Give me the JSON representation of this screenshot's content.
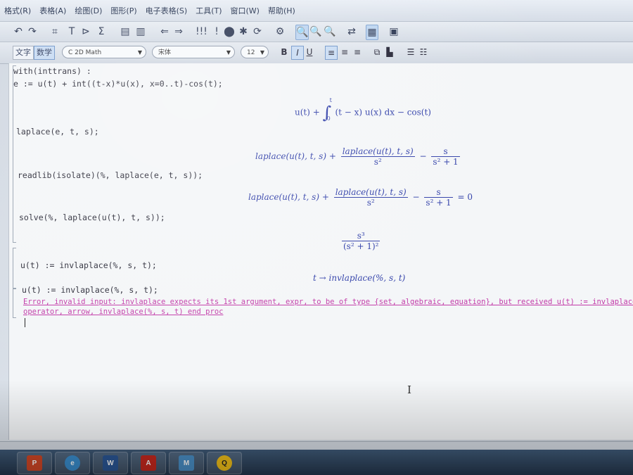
{
  "menu": [
    "格式(R)",
    "表格(A)",
    "绘图(D)",
    "图形(P)",
    "电子表格(S)",
    "工具(T)",
    "窗口(W)",
    "帮助(H)"
  ],
  "toolbar2": {
    "text_mode": "文字",
    "math_mode": "数学",
    "style_combo": "C 2D Math",
    "font_combo": "宋体",
    "size_combo": "12",
    "bold": "B",
    "italic": "I",
    "underline": "U"
  },
  "worksheet": {
    "inputs": [
      "with(inttrans) :",
      "e := u(t) + int((t-x)*u(x), x=0..t)-cos(t);",
      "laplace(e, t, s);",
      "readlib(isolate)(%, laplace(e, t, s));",
      "solve(%, laplace(u(t), t, s));",
      "u(t) := invlaplace(%, s, t);",
      "u(t) := invlaplace(%, s, t);"
    ],
    "outputs": {
      "o1": {
        "lead": "u(t) + ",
        "integrand": "(t − x) u(x) dx − cos(t)",
        "upper": "t",
        "lower": "0"
      },
      "o2": {
        "a": "laplace(u(t), t, s) + ",
        "num": "laplace(u(t), t, s)",
        "den": "s²",
        "minus": " − ",
        "num2": "s",
        "den2": "s² + 1"
      },
      "o3": {
        "a": "laplace(u(t), t, s) + ",
        "num": "laplace(u(t), t, s)",
        "den": "s²",
        "minus": " − ",
        "num2": "s",
        "den2": "s² + 1",
        "rhs": " = 0"
      },
      "o4": {
        "num": "s³",
        "den": "(s² + 1)²"
      },
      "o5": "t → invlaplace(%, s, t)"
    },
    "error_line1": "Error, invalid input: invlaplace expects its 1st argument, expr, to be of type {set, algebraic, equation}, but received u(t) := invlaplace",
    "error_line2": "operator, arrow, invlaplace(%, s, t) end proc"
  },
  "taskbar": {
    "apps": [
      "pptx-icon",
      "browser-icon",
      "word-icon",
      "pdf-icon",
      "app-icon",
      "qq-icon"
    ]
  }
}
